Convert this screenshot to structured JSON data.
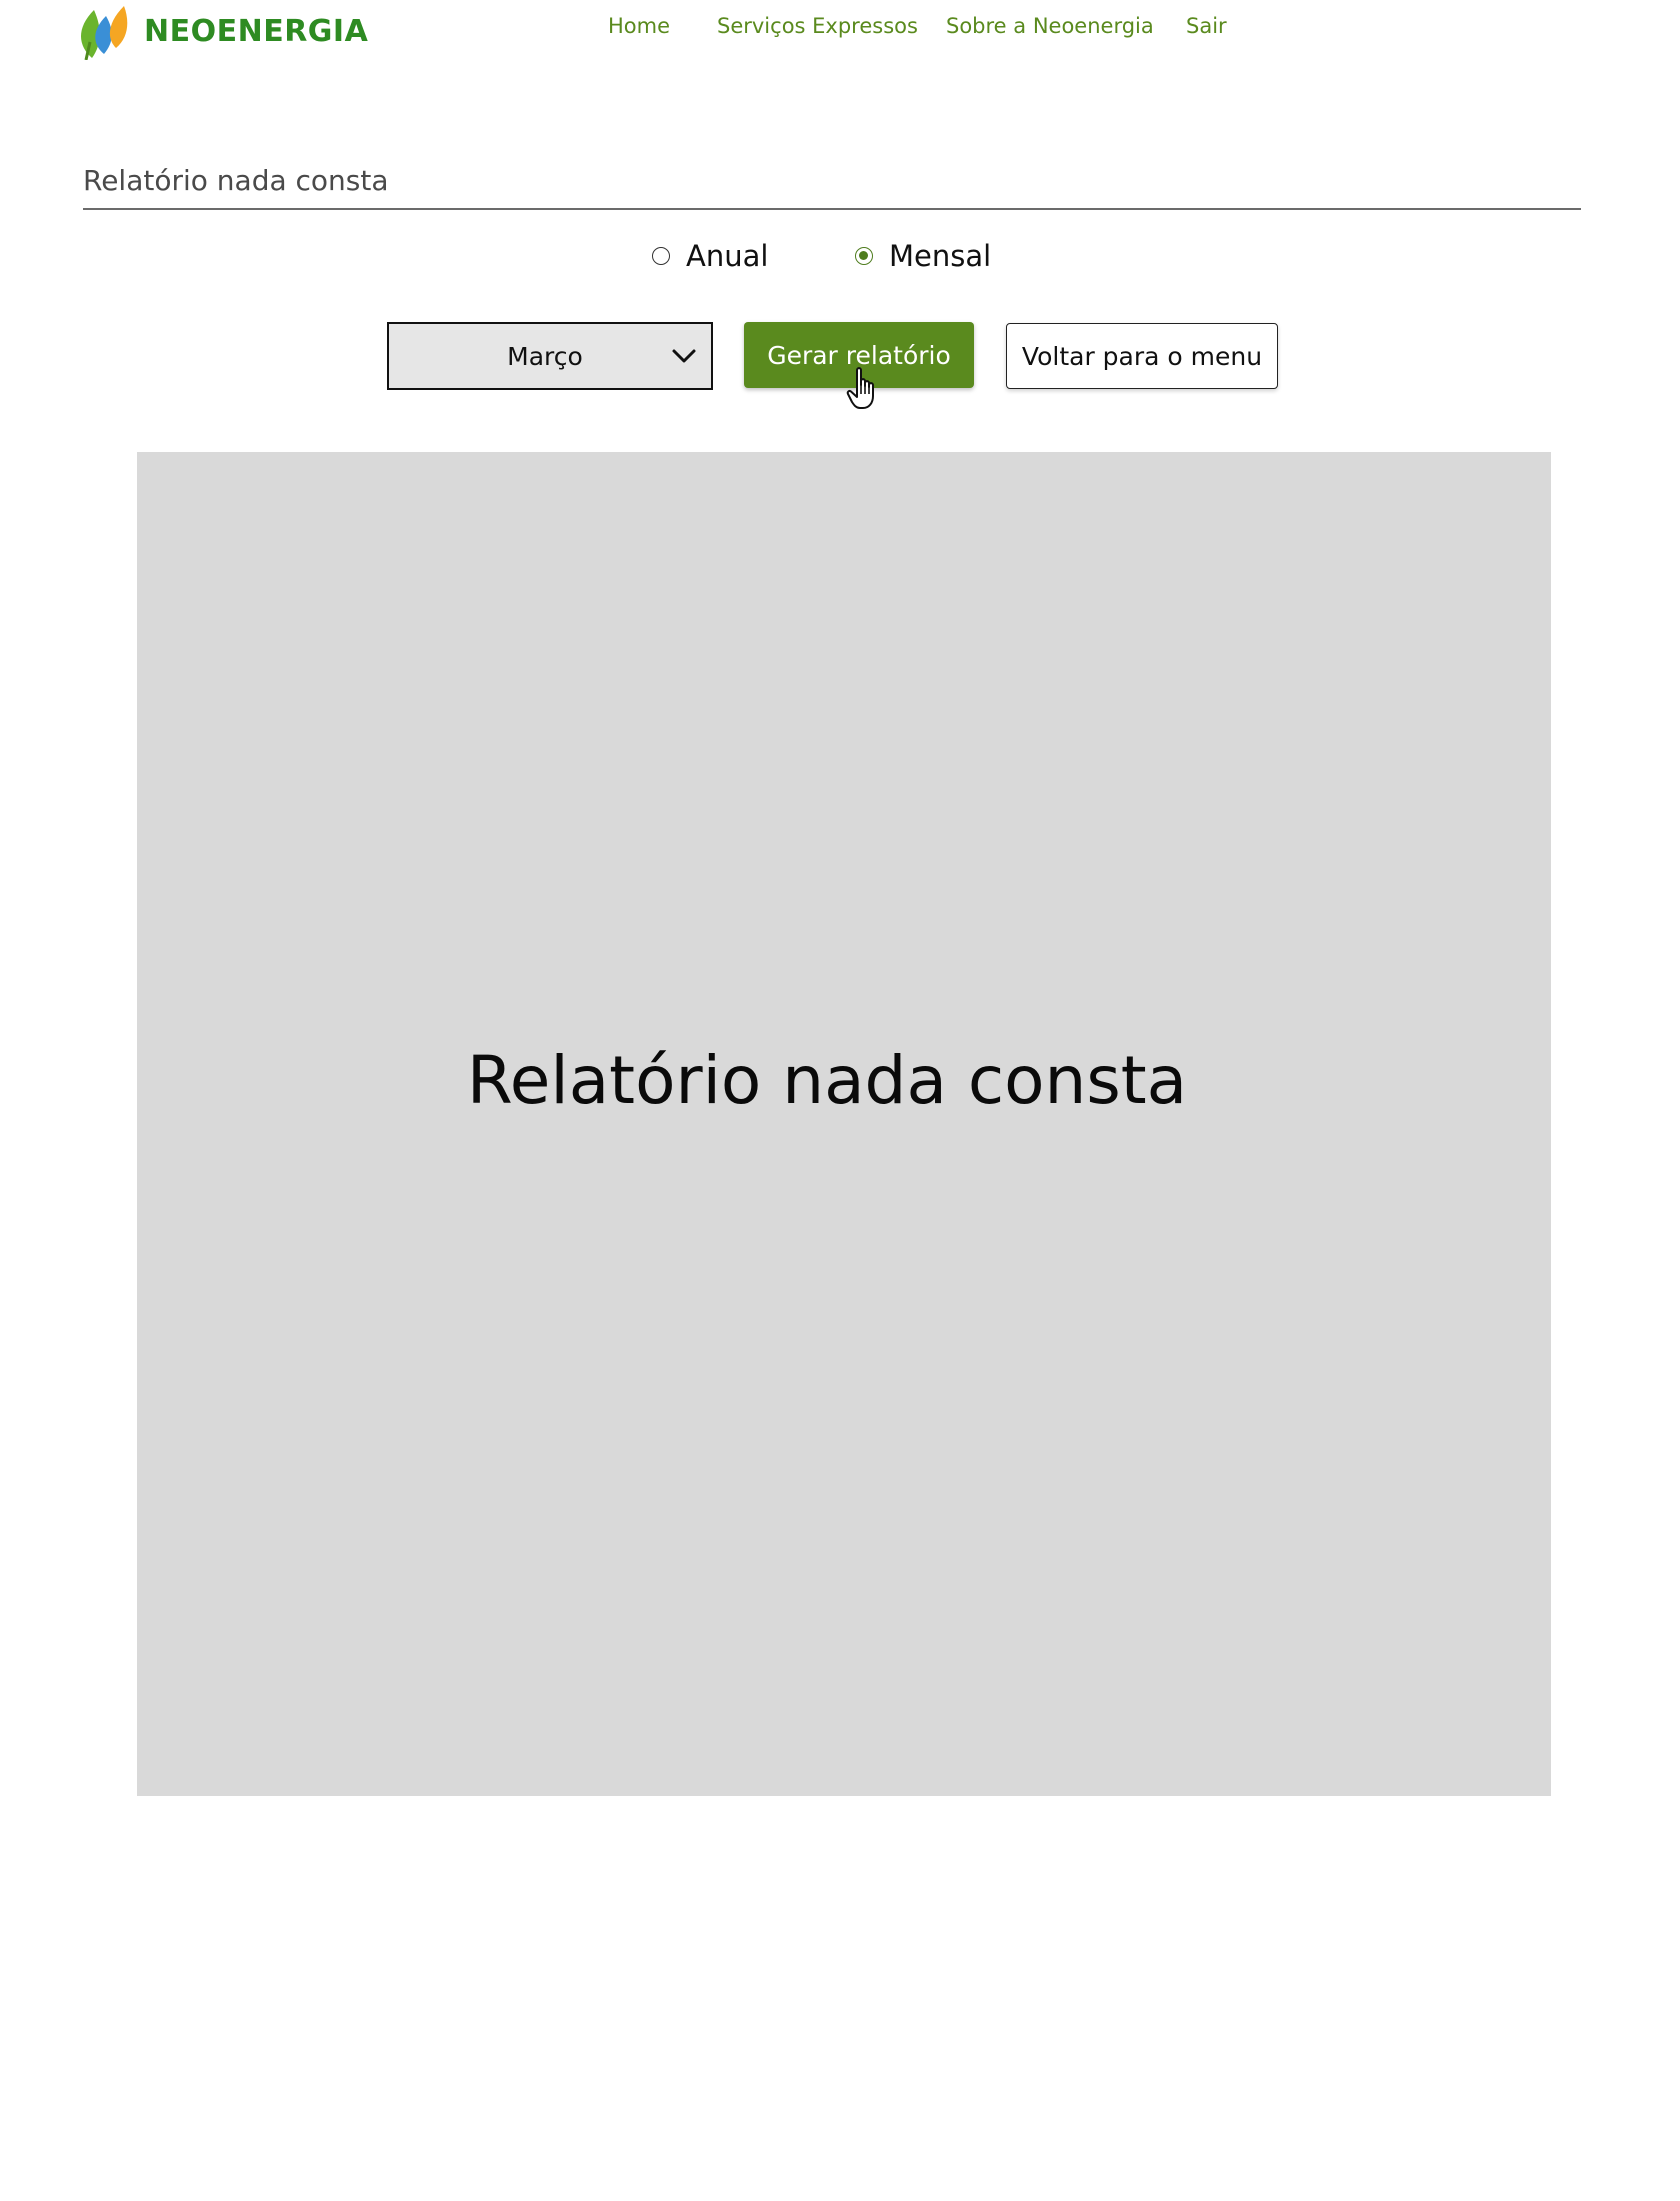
{
  "brand": {
    "name": "NEOENERGIA",
    "colors": {
      "text_green": "#2e8b22",
      "nav_green": "#5a8a1e",
      "leaf_green": "#6ab42d",
      "leaf_blue": "#3a8fd6",
      "leaf_orange": "#f5a623"
    }
  },
  "nav": {
    "items": [
      {
        "label": "Home"
      },
      {
        "label": "Serviços Expressos"
      },
      {
        "label": "Sobre a Neoenergia"
      },
      {
        "label": "Sair"
      }
    ]
  },
  "page": {
    "title": "Relatório nada consta"
  },
  "period": {
    "options": [
      {
        "label": "Anual",
        "selected": false
      },
      {
        "label": "Mensal",
        "selected": true
      }
    ]
  },
  "controls": {
    "month_select_value": "Março",
    "generate_label": "Gerar relatório",
    "back_label": "Voltar para o menu",
    "icons": {
      "dropdown": "chevron-down-icon",
      "cursor": "hand-pointer-icon"
    }
  },
  "report": {
    "text": "Relatório nada consta",
    "background": "#d9d9d9"
  }
}
